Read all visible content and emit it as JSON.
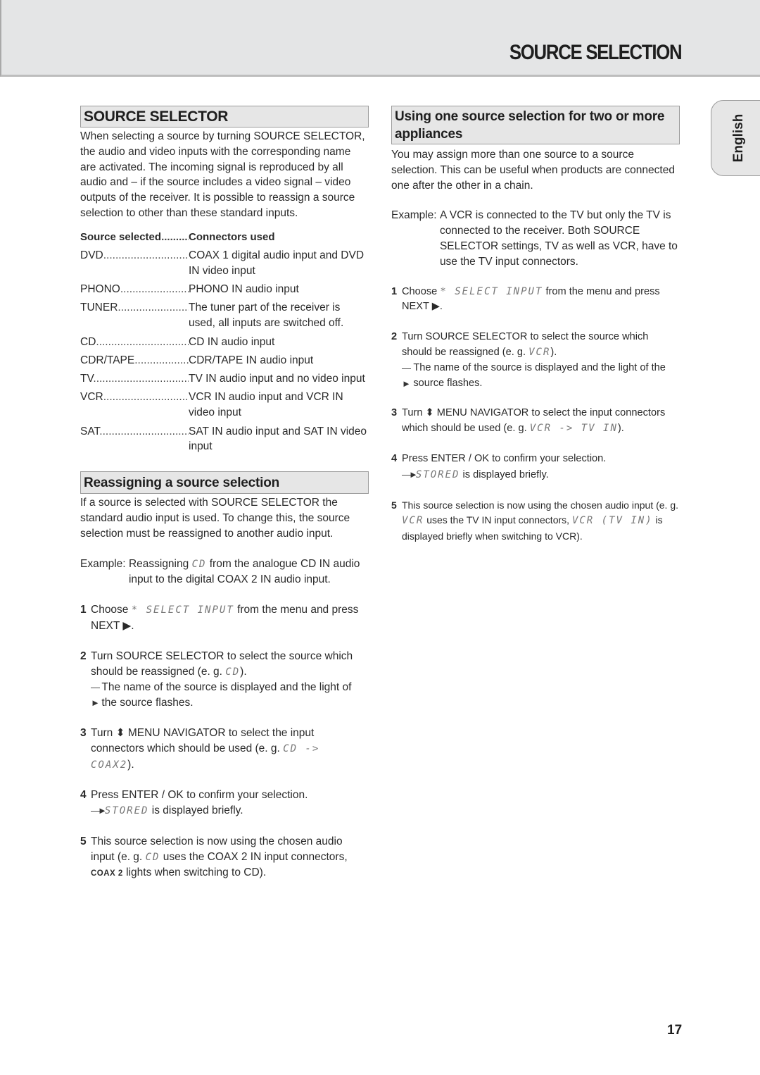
{
  "header": {
    "title": "SOURCE SELECTION"
  },
  "language_tab": "English",
  "left": {
    "source_selector": {
      "title": "SOURCE SELECTOR",
      "intro": "When selecting a source by turning SOURCE SELECTOR, the audio and video inputs with the corresponding name are activated. The incoming signal is reproduced by all audio and – if the source includes a video signal – video outputs of the receiver. It is possible to reassign a source selection to other than these standard inputs.",
      "table": {
        "col_source": "Source selected",
        "col_connectors": "Connectors used",
        "rows": [
          {
            "source": "DVD",
            "connectors": "COAX 1 digital audio input and DVD IN video input"
          },
          {
            "source": "PHONO",
            "connectors": "PHONO IN audio input"
          },
          {
            "source": "TUNER",
            "connectors": "The tuner part of the receiver is used, all inputs are switched off."
          },
          {
            "source": "CD",
            "connectors": "CD IN audio input"
          },
          {
            "source": "CDR/TAPE",
            "connectors": "CDR/TAPE IN audio input"
          },
          {
            "source": "TV",
            "connectors": "TV IN audio input and no video input"
          },
          {
            "source": "VCR",
            "connectors": "VCR IN audio input and VCR IN video input"
          },
          {
            "source": "SAT",
            "connectors": "SAT IN audio input and SAT IN video input"
          }
        ]
      }
    },
    "reassigning": {
      "title": "Reassigning a source selection",
      "intro": "If a source is selected with SOURCE SELECTOR the standard audio input is used. To change this, the source selection must be reassigned to another audio input.",
      "example_label": "Example:",
      "example_pre": "Reassigning",
      "example_lcd": "CD",
      "example_post": "from the analogue CD IN audio input to the digital COAX 2 IN audio input.",
      "steps": [
        {
          "num": "1",
          "pre": "Choose",
          "lcd": "* SELECT INPUT",
          "post": "from the menu and press NEXT ▶."
        },
        {
          "num": "2",
          "pre": "Turn SOURCE SELECTOR to select the source which should be reassigned (e. g.",
          "lcd": "CD",
          "post": ").",
          "result": "The name of the source is displayed and the light of the source flashes."
        },
        {
          "num": "3",
          "pre": "Turn ⬍ MENU NAVIGATOR to select the input connectors which should be used (e. g.",
          "lcd": "CD -> COAX2",
          "post": ")."
        },
        {
          "num": "4",
          "pre": "Press ENTER / OK to confirm your selection.",
          "result_lcd": "STORED",
          "result_post": "is displayed briefly."
        },
        {
          "num": "5",
          "pre": "This source selection is now using the chosen audio input (e. g.",
          "lcd": "CD",
          "post": "uses the COAX 2 IN input connectors,",
          "badge": "COAX  2",
          "post2": "lights when switching to CD)."
        }
      ]
    }
  },
  "right": {
    "using_one": {
      "title": "Using one source selection for two or more appliances",
      "intro": "You may assign more than one source to a source selection. This can be useful when products are connected one after the other in a chain.",
      "example_label": "Example:",
      "example_text": "A VCR is connected to the TV but only the TV is connected to the receiver. Both SOURCE SELECTOR settings, TV as well as VCR, have to use the TV input connectors.",
      "steps": [
        {
          "num": "1",
          "pre": "Choose",
          "lcd": "* SELECT INPUT",
          "post": "from the menu and press NEXT ▶."
        },
        {
          "num": "2",
          "pre": "Turn SOURCE SELECTOR to select the source which should be reassigned (e. g.",
          "lcd": "VCR",
          "post": ").",
          "result": "The name of the source is displayed and the light of the source flashes."
        },
        {
          "num": "3",
          "pre": "Turn ⬍ MENU NAVIGATOR to select the input connectors which should be used (e. g.",
          "lcd": "VCR -> TV IN",
          "post": ")."
        },
        {
          "num": "4",
          "pre": "Press ENTER / OK to confirm your selection.",
          "result_lcd": "STORED",
          "result_post": "is displayed briefly."
        },
        {
          "num": "5",
          "pre": "This source selection is now using the chosen audio input (e. g.",
          "lcd": "VCR",
          "post": "uses the TV IN input connectors,",
          "lcd2": "VCR (TV IN)",
          "post2": "is displayed briefly when switching to VCR)."
        }
      ]
    }
  },
  "page_number": "17"
}
